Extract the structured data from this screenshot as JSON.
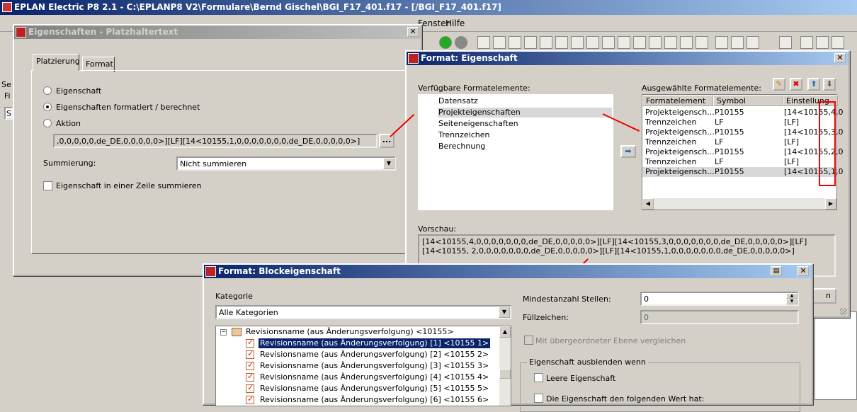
{
  "app": {
    "title": "EPLAN Electric P8 2.1 - C:\\EPLANP8 V2\\Formulare\\Bernd Gischel\\BGI_F17_401.f17 - [/BGI_F17_401.f17]"
  },
  "menu": {
    "fenster": "Fenster",
    "hilfe": "Hilfe"
  },
  "bg": {
    "se": "Se",
    "fi": "Fi",
    "s": "S"
  },
  "platz": {
    "title": "Eigenschaften - Platzhaltertext",
    "tab1": "Platzierung",
    "tab2": "Format",
    "r1": "Eigenschaft",
    "r2": "Eigenschaften formatiert / berechnet",
    "r3": "Aktion",
    "value": ",0,0,0,0,0,de_DE,0,0,0,0,0>][LF][14<10155,1,0,0,0,0,0,0,0,de_DE,0,0,0,0,0>]",
    "dots": "...",
    "summ_label": "Summierung:",
    "summ_value": "Nicht summieren",
    "zeile": "Eigenschaft in einer Zeile summieren"
  },
  "fmt": {
    "title": "Format: Eigenschaft",
    "avail_label": "Verfügbare Formatelemente:",
    "avail": [
      "Datensatz",
      "Projekteigenschaften",
      "Seiteneigenschaften",
      "Trennzeichen",
      "Berechnung"
    ],
    "sel_label": "Ausgewählte Formatelemente:",
    "cols": [
      "Formatelement",
      "Symbol",
      "Einstellung"
    ],
    "rows": [
      [
        "Projekteigensch...",
        "P10155",
        "[14<10155,4,0"
      ],
      [
        "Trennzeichen",
        "LF",
        "[LF]"
      ],
      [
        "Projekteigensch...",
        "P10155",
        "[14<10155,3,0"
      ],
      [
        "Trennzeichen",
        "LF",
        "[LF]"
      ],
      [
        "Projekteigensch...",
        "P10155",
        "[14<10155,2,0"
      ],
      [
        "Trennzeichen",
        "LF",
        "[LF]"
      ],
      [
        "Projekteigensch...",
        "P10155",
        "[14<10155,1,0"
      ]
    ],
    "preview_label": "Vorschau:",
    "preview": "[14<10155,4,0,0,0,0,0,0,0,de_DE,0,0,0,0,0>][LF][14<10155,3,0,0,0,0,0,0,0,de_DE,0,0,0,0,0>][LF][14<10155, 2,0,0,0,0,0,0,0,de_DE,0,0,0,0,0>][LF][14<10155,1,0,0,0,0,0,0,0,de_DE,0,0,0,0,0>]",
    "btn_partial": "n"
  },
  "block": {
    "title": "Format: Blockeigenschaft",
    "kat_label": "Kategorie",
    "kat_value": "Alle Kategorien",
    "tree_root": "Revisionsname (aus Änderungsverfolgung) <10155>",
    "tree_items": [
      "Revisionsname (aus Änderungsverfolgung) [1] <10155 1>",
      "Revisionsname (aus Änderungsverfolgung) [2] <10155 2>",
      "Revisionsname (aus Änderungsverfolgung) [3] <10155 3>",
      "Revisionsname (aus Änderungsverfolgung) [4] <10155 4>",
      "Revisionsname (aus Änderungsverfolgung) [5] <10155 5>",
      "Revisionsname (aus Änderungsverfolgung) [6] <10155 6>"
    ],
    "min_label": "Mindestanzahl Stellen:",
    "min_value": "0",
    "fill_label": "Füllzeichen:",
    "fill_value": "0",
    "compare": "Mit übergeordneter Ebene vergleichen",
    "group": "Eigenschaft ausblenden wenn",
    "leer": "Leere Eigenschaft",
    "wert": "Die Eigenschaft den folgenden Wert hat:"
  }
}
